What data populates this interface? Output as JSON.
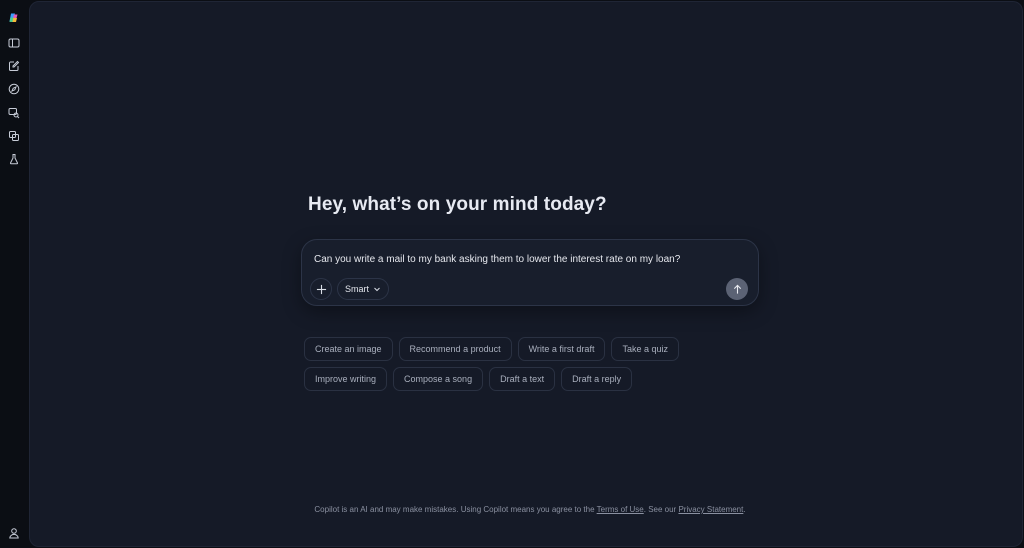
{
  "sidebar": {
    "items": [
      {
        "name": "copilot-logo",
        "icon": "copilot-logo-icon"
      },
      {
        "name": "toggle-sidebar",
        "icon": "sidebar-panel-icon"
      },
      {
        "name": "new-chat",
        "icon": "compose-icon"
      },
      {
        "name": "discover",
        "icon": "compass-icon"
      },
      {
        "name": "search-chats",
        "icon": "chat-search-icon"
      },
      {
        "name": "pages",
        "icon": "pages-icon"
      },
      {
        "name": "labs",
        "icon": "flask-icon"
      }
    ],
    "profile_icon": "user-icon"
  },
  "main": {
    "greeting": "Hey, what’s on your mind today?",
    "composer": {
      "value": "Can you write a mail to my bank asking them to lower the interest rate on my loan?",
      "mode_label": "Smart"
    },
    "suggestions": {
      "row1": [
        "Create an image",
        "Recommend a product",
        "Write a first draft",
        "Take a quiz"
      ],
      "row2": [
        "Improve writing",
        "Compose a song",
        "Draft a text",
        "Draft a reply"
      ]
    },
    "footer": {
      "prefix": "Copilot is an AI and may make mistakes. Using Copilot means you agree to the ",
      "terms_link": "Terms of Use",
      "middle": ". See our ",
      "privacy_link": "Privacy Statement",
      "suffix": "."
    }
  },
  "colors": {
    "background": "#0b0e14",
    "panel": "#151a27",
    "composer": "#181e2c",
    "send_button": "#5b6274"
  }
}
